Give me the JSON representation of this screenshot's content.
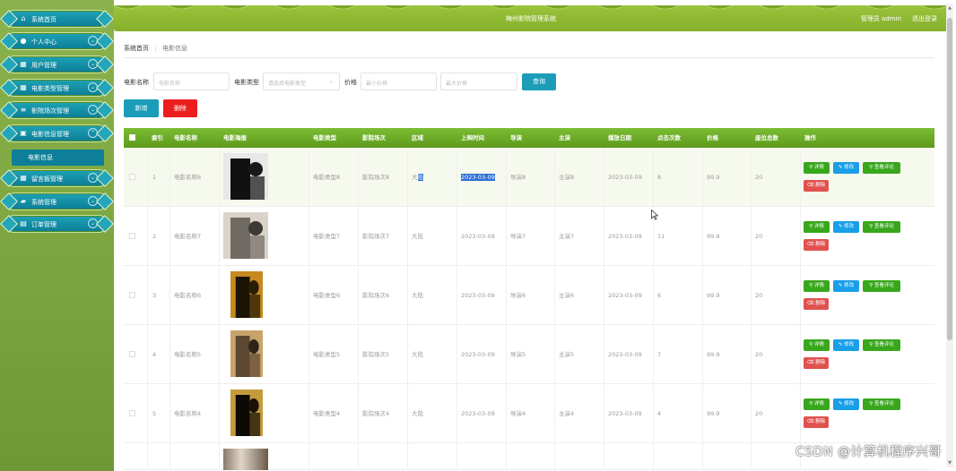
{
  "app": {
    "title": "梅州影院管理系统",
    "role_label": "管理员 admin",
    "logout_label": "退出登录"
  },
  "sidebar": {
    "items": [
      {
        "label": "系统首页",
        "icon": "home-icon",
        "glyph": "⌂",
        "chevron": false
      },
      {
        "label": "个人中心",
        "icon": "user-icon",
        "glyph": "●",
        "chevron": true
      },
      {
        "label": "用户管理",
        "icon": "grid-icon",
        "glyph": "▦",
        "chevron": true
      },
      {
        "label": "电影类型管理",
        "icon": "grid-icon",
        "glyph": "▦",
        "chevron": true
      },
      {
        "label": "影院场次管理",
        "icon": "sliders-icon",
        "glyph": "≡",
        "chevron": true
      },
      {
        "label": "电影信息管理",
        "icon": "film-icon",
        "glyph": "▣",
        "chevron": true
      },
      {
        "label": "留言板管理",
        "icon": "grid-icon",
        "glyph": "▦",
        "chevron": true
      },
      {
        "label": "系统管理",
        "icon": "folder-icon",
        "glyph": "▰",
        "chevron": true
      },
      {
        "label": "订单管理",
        "icon": "clipboard-icon",
        "glyph": "▤",
        "chevron": true
      }
    ],
    "active_sub": "电影信息"
  },
  "breadcrumb": {
    "home": "系统首页",
    "sep": "⋮",
    "current": "电影信息"
  },
  "search": {
    "name_label": "电影名称",
    "name_placeholder": "电影名称",
    "type_label": "电影类型",
    "type_placeholder": "请选择电影类型",
    "price_label": "价格",
    "min_placeholder": "最小价格",
    "max_placeholder": "最大价格",
    "query_label": "查询"
  },
  "actions": {
    "add_label": "新增",
    "delete_label": "删除"
  },
  "table": {
    "headers": [
      "索引",
      "电影名称",
      "电影海报",
      "电影类型",
      "影院场次",
      "区域",
      "上映时间",
      "导演",
      "主演",
      "播放日期",
      "点击次数",
      "价格",
      "座位总数",
      "操作"
    ],
    "rows": [
      {
        "index": "1",
        "name": "电影名称8",
        "type": "电影类型8",
        "session": "影院场次8",
        "region": "大陆",
        "release": "2023-03-09",
        "director": "导演8",
        "actor": "主演8",
        "play_date": "2023-03-09",
        "clicks": "8",
        "price": "99.9",
        "seats": "20"
      },
      {
        "index": "2",
        "name": "电影名称7",
        "type": "电影类型7",
        "session": "影院场次7",
        "region": "大陆",
        "release": "2023-03-09",
        "director": "导演7",
        "actor": "主演7",
        "play_date": "2023-03-09",
        "clicks": "11",
        "price": "99.9",
        "seats": "20"
      },
      {
        "index": "3",
        "name": "电影名称6",
        "type": "电影类型6",
        "session": "影院场次6",
        "region": "大陆",
        "release": "2023-03-09",
        "director": "导演6",
        "actor": "主演6",
        "play_date": "2023-03-09",
        "clicks": "6",
        "price": "99.9",
        "seats": "20"
      },
      {
        "index": "4",
        "name": "电影名称5",
        "type": "电影类型5",
        "session": "影院场次5",
        "region": "大陆",
        "release": "2023-03-09",
        "director": "导演5",
        "actor": "主演5",
        "play_date": "2023-03-09",
        "clicks": "7",
        "price": "99.9",
        "seats": "20"
      },
      {
        "index": "5",
        "name": "电影名称4",
        "type": "电影类型4",
        "session": "影院场次4",
        "region": "大陆",
        "release": "2023-03-09",
        "director": "导演4",
        "actor": "主演4",
        "play_date": "2023-03-09",
        "clicks": "4",
        "price": "99.9",
        "seats": "20"
      }
    ],
    "op_labels": {
      "detail": "详情",
      "edit": "修改",
      "review": "查看评论",
      "delete": "删除"
    }
  },
  "watermark": "CSDN @计算机程序兴哥"
}
